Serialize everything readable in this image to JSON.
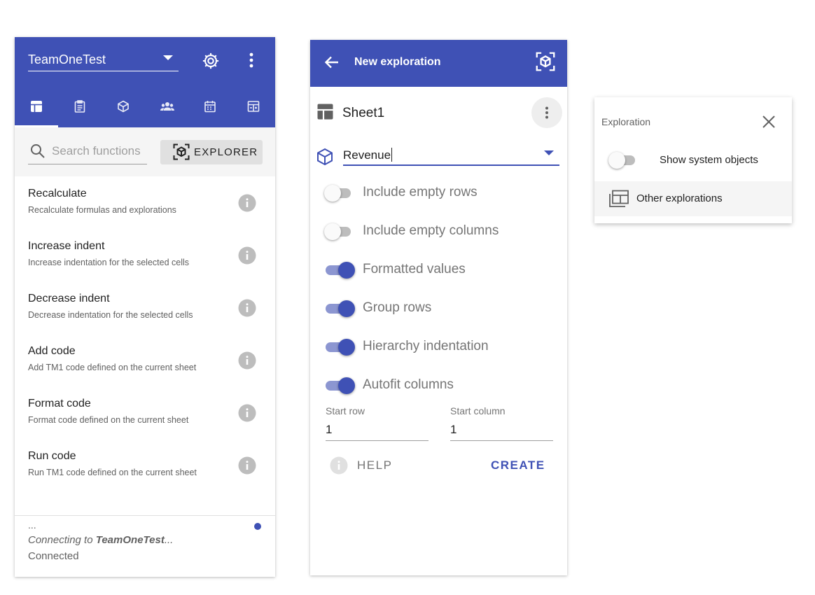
{
  "functions_panel": {
    "workspace": "TeamOneTest",
    "tabs": [
      "functions",
      "reports",
      "cubes",
      "users",
      "calendar",
      "sheets"
    ],
    "search": {
      "placeholder": "Search functions",
      "value": ""
    },
    "explorer_label": "EXPLORER",
    "functions": [
      {
        "title": "Recalculate",
        "description": "Recalculate formulas and explorations"
      },
      {
        "title": "Increase indent",
        "description": "Increase indentation for the selected cells"
      },
      {
        "title": "Decrease indent",
        "description": "Decrease indentation for the selected cells"
      },
      {
        "title": "Add code",
        "description": "Add TM1 code defined on the current sheet"
      },
      {
        "title": "Format code",
        "description": "Format code defined on the current sheet"
      },
      {
        "title": "Run code",
        "description": "Run TM1 code defined on the current sheet"
      }
    ],
    "status": {
      "dots": "...",
      "connecting_prefix": "Connecting to ",
      "connecting_target": "TeamOneTest",
      "connecting_suffix": "...",
      "connected": "Connected"
    }
  },
  "exploration_panel": {
    "title": "New exploration",
    "sheet": "Sheet1",
    "cube": "Revenue",
    "options": [
      {
        "label": "Include empty rows",
        "on": false
      },
      {
        "label": "Include empty columns",
        "on": false
      },
      {
        "label": "Formatted values",
        "on": true
      },
      {
        "label": "Group rows",
        "on": true
      },
      {
        "label": "Hierarchy indentation",
        "on": true
      },
      {
        "label": "Autofit columns",
        "on": true
      }
    ],
    "start_row": {
      "label": "Start row",
      "value": "1"
    },
    "start_column": {
      "label": "Start column",
      "value": "1"
    },
    "help_label": "HELP",
    "create_label": "CREATE"
  },
  "exploration_menu": {
    "title": "Exploration",
    "show_system_objects": {
      "label": "Show system objects",
      "on": false
    },
    "other_explorations": "Other explorations"
  },
  "colors": {
    "primary": "#3f51b5",
    "toggle_on_track": "#8c96d1",
    "toggle_off_track": "#bdbdbd"
  }
}
